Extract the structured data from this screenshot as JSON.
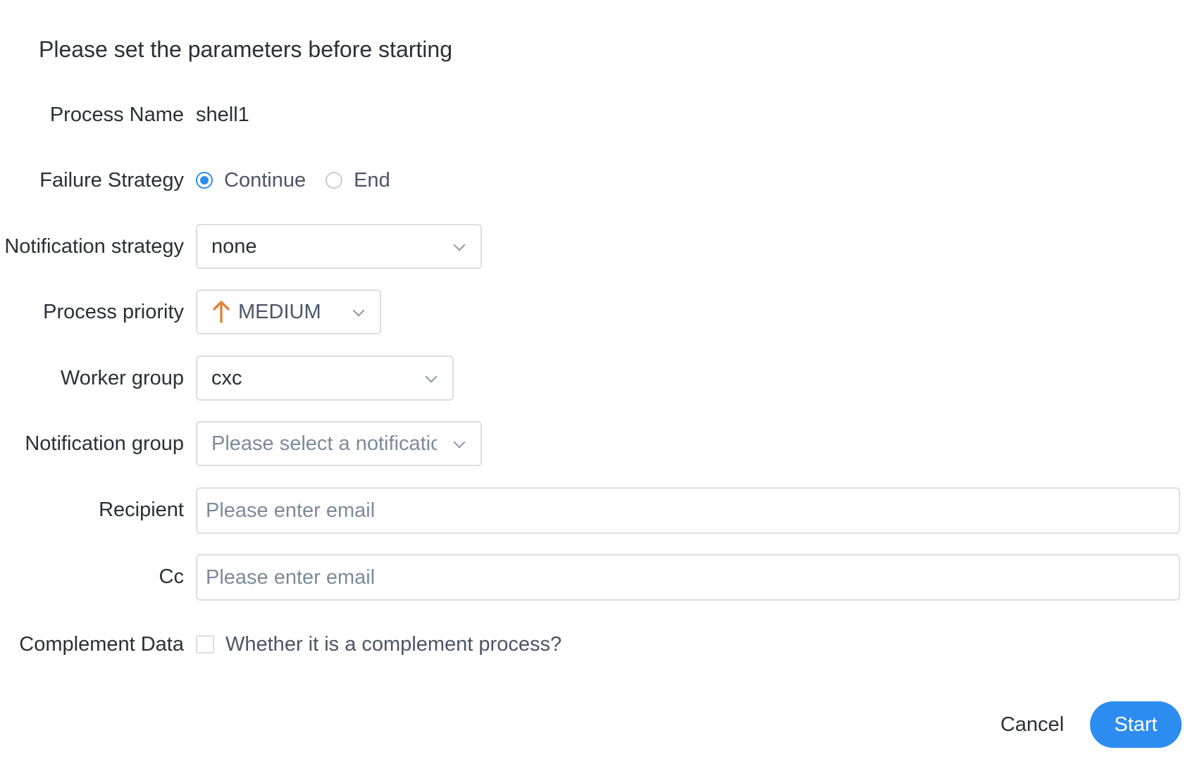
{
  "dialog": {
    "title": "Please set the parameters before starting"
  },
  "form": {
    "process_name": {
      "label": "Process Name",
      "value": "shell1"
    },
    "failure_strategy": {
      "label": "Failure Strategy",
      "options": [
        {
          "label": "Continue",
          "checked": true
        },
        {
          "label": "End",
          "checked": false
        }
      ]
    },
    "notification_strategy": {
      "label": "Notification strategy",
      "value": "none"
    },
    "process_priority": {
      "label": "Process priority",
      "value": "MEDIUM",
      "icon": "arrow-up-icon",
      "icon_color": "#e3853d"
    },
    "worker_group": {
      "label": "Worker group",
      "value": "cxc"
    },
    "notification_group": {
      "label": "Notification group",
      "placeholder": "Please select a notificatic"
    },
    "recipient": {
      "label": "Recipient",
      "value": "",
      "placeholder": "Please enter email"
    },
    "cc": {
      "label": "Cc",
      "value": "",
      "placeholder": "Please enter email"
    },
    "complement_data": {
      "label": "Complement Data",
      "checkbox_label": "Whether it is a complement process?",
      "checked": false
    }
  },
  "footer": {
    "cancel_label": "Cancel",
    "start_label": "Start"
  },
  "colors": {
    "accent": "#2d8cf0",
    "priority_medium": "#e3853d",
    "border": "#dcdee2"
  }
}
